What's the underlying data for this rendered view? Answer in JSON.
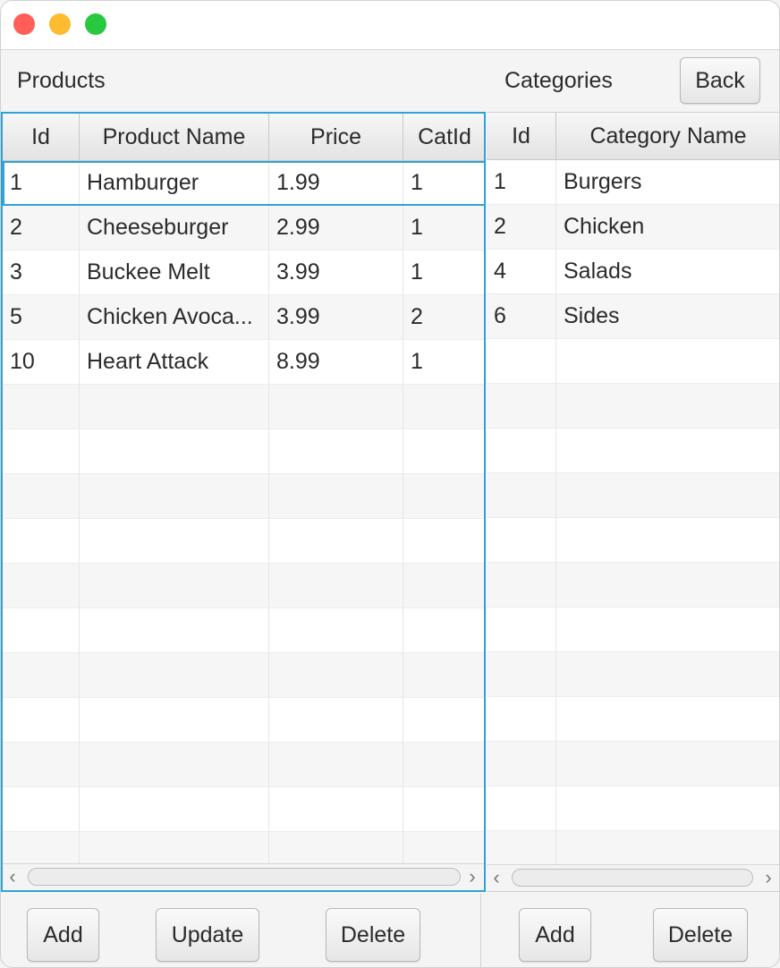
{
  "labels": {
    "products": "Products",
    "categories": "Categories"
  },
  "buttons": {
    "back": "Back",
    "products_add": "Add",
    "products_update": "Update",
    "products_delete": "Delete",
    "categories_add": "Add",
    "categories_delete": "Delete"
  },
  "products_table": {
    "columns": [
      "Id",
      "Product Name",
      "Price",
      "CatId"
    ],
    "rows": [
      [
        "1",
        "Hamburger",
        "1.99",
        "1"
      ],
      [
        "2",
        "Cheeseburger",
        "2.99",
        "1"
      ],
      [
        "3",
        "Buckee Melt",
        "3.99",
        "1"
      ],
      [
        "5",
        "Chicken Avoca...",
        "3.99",
        "2"
      ],
      [
        "10",
        "Heart Attack",
        "8.99",
        "1"
      ]
    ],
    "selected_row": 0
  },
  "categories_table": {
    "columns": [
      "Id",
      "Category Name"
    ],
    "rows": [
      [
        "1",
        "Burgers"
      ],
      [
        "2",
        "Chicken"
      ],
      [
        "4",
        "Salads"
      ],
      [
        "6",
        "Sides"
      ]
    ]
  },
  "colors": {
    "focus": "#2fa3d6",
    "close": "#fe5f57",
    "minimize": "#febc2e",
    "maximize": "#28c840"
  },
  "icons": {
    "scroll_left": "‹",
    "scroll_right": "›"
  }
}
